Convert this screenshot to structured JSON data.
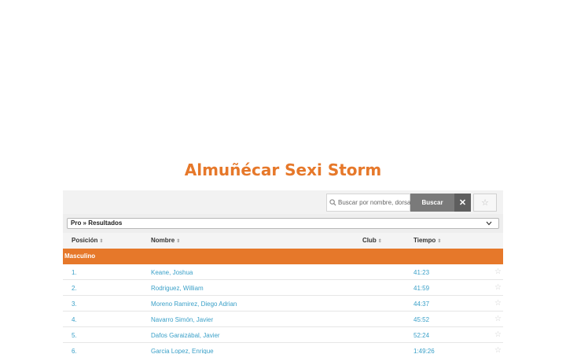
{
  "event": {
    "title": "Almuñécar Sexi Storm"
  },
  "toolbar": {
    "search_placeholder": "Buscar por nombre, dorsal, club...",
    "search_button": "Buscar"
  },
  "selector": {
    "value": "Pro » Resultados"
  },
  "table": {
    "columns": [
      "Posición",
      "Nombre",
      "Club",
      "Tiempo"
    ],
    "group": "Masculino",
    "rows": [
      {
        "pos": "1.",
        "name": "Keane, Joshua",
        "club": "",
        "time": "41:23"
      },
      {
        "pos": "2.",
        "name": "Rodriguez, William",
        "club": "",
        "time": "41:59"
      },
      {
        "pos": "3.",
        "name": "Moreno Ramirez, Diego Adrian",
        "club": "",
        "time": "44:37"
      },
      {
        "pos": "4.",
        "name": "Navarro Simón, Javier",
        "club": "",
        "time": "45:52"
      },
      {
        "pos": "5.",
        "name": "Dafos Garaizábal, Javier",
        "club": "",
        "time": "52:24"
      },
      {
        "pos": "6.",
        "name": "Garcia Lopez, Enrique",
        "club": "",
        "time": "1:49:26"
      }
    ]
  }
}
